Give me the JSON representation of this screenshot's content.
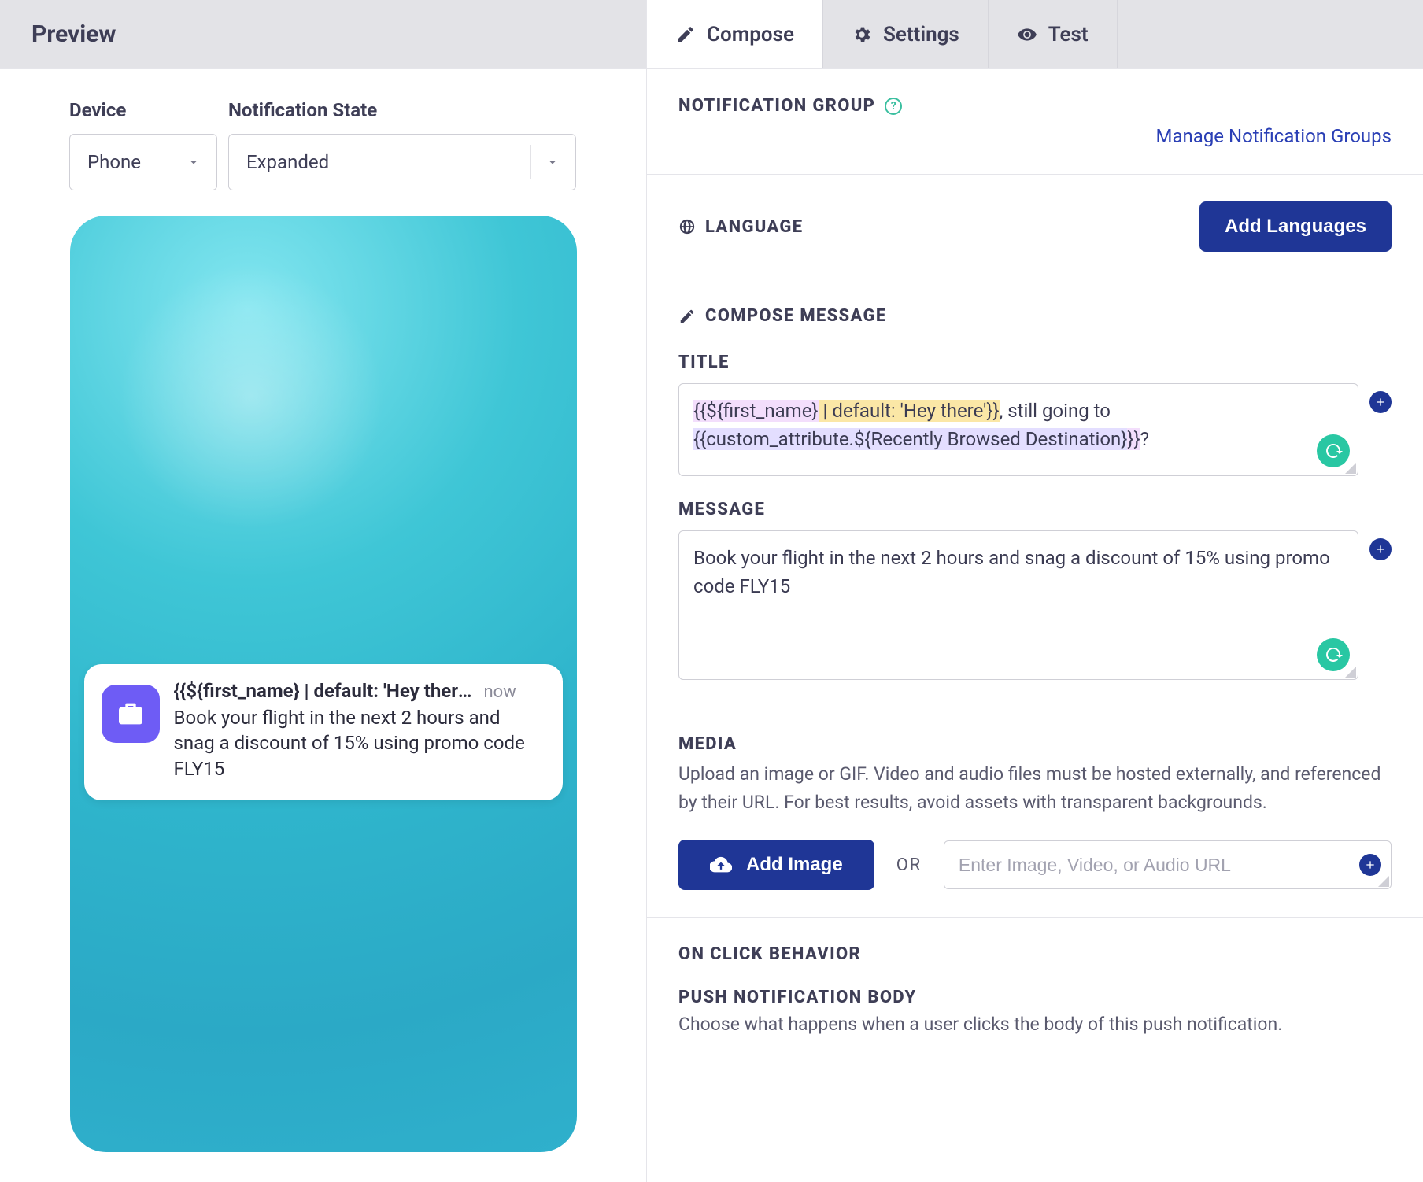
{
  "preview": {
    "title": "Preview",
    "deviceLabel": "Device",
    "stateLabel": "Notification State",
    "deviceValue": "Phone",
    "stateValue": "Expanded"
  },
  "notification": {
    "title": "{{${first_name} | default: 'Hey there...",
    "time": "now",
    "body": "Book your flight in the next 2 hours and snag a discount of 15% using promo code FLY15"
  },
  "tabs": {
    "compose": "Compose",
    "settings": "Settings",
    "test": "Test"
  },
  "notifGroup": {
    "title": "NOTIFICATION GROUP",
    "manageLink": "Manage Notification Groups"
  },
  "language": {
    "title": "LANGUAGE",
    "addBtn": "Add Languages"
  },
  "compose": {
    "title": "COMPOSE MESSAGE",
    "titleLabel": "TITLE",
    "titleValue": {
      "seg1": "{{${first_name}",
      "seg2": " | default: 'Hey there'}}",
      "seg3": ", still going to ",
      "seg4": "{{custom_attribute.${Recently Browsed Destination}",
      "seg5": "}}",
      "seg6": "?"
    },
    "messageLabel": "MESSAGE",
    "messageValue": "Book your flight in the next 2 hours and snag a discount of 15% using promo code FLY15"
  },
  "media": {
    "title": "MEDIA",
    "desc": "Upload an image or GIF. Video and audio files must be hosted externally, and referenced by their URL. For best results, avoid assets with transparent backgrounds.",
    "addBtn": "Add Image",
    "or": "OR",
    "placeholder": "Enter Image, Video, or Audio URL"
  },
  "onClick": {
    "title": "ON CLICK BEHAVIOR",
    "bodyTitle": "PUSH NOTIFICATION BODY",
    "bodyDesc": "Choose what happens when a user clicks the body of this push notification."
  }
}
